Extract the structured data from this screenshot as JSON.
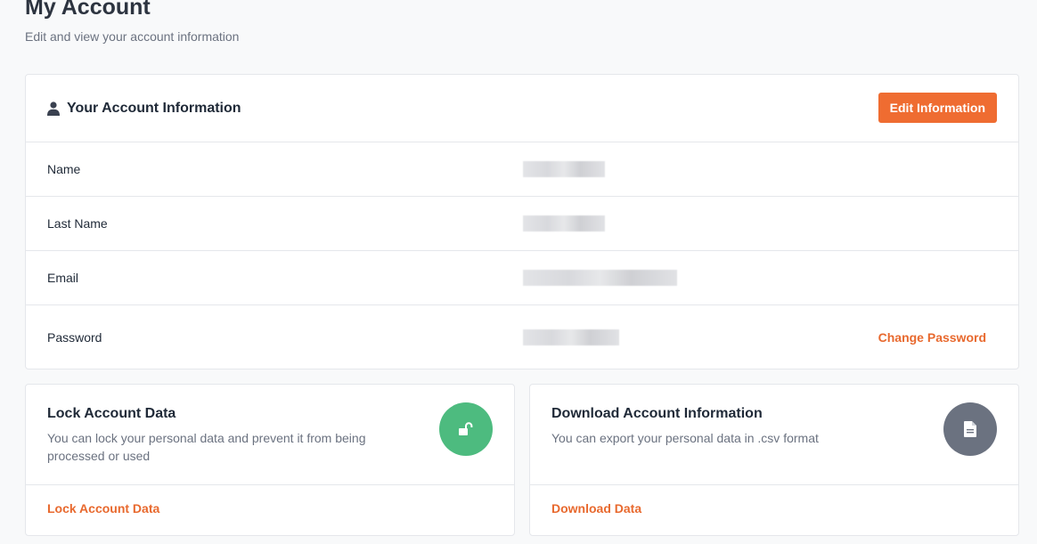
{
  "header": {
    "title": "My Account",
    "subtitle": "Edit and view your account information"
  },
  "account_info": {
    "title": "Your Account Information",
    "edit_label": "Edit Information",
    "rows": [
      {
        "label": "Name"
      },
      {
        "label": "Last Name"
      },
      {
        "label": "Email"
      },
      {
        "label": "Password"
      }
    ],
    "change_password_label": "Change Password"
  },
  "lock_card": {
    "title": "Lock Account Data",
    "description": "You can lock your personal data and prevent it from being processed or used",
    "link_label": "Lock Account Data",
    "icon": "unlock-icon",
    "icon_bg": "#4dbb7f"
  },
  "download_card": {
    "title": "Download Account Information",
    "description": "You can export your personal data in .csv format",
    "link_label": "Download Data",
    "icon": "document-icon",
    "icon_bg": "#6b7280"
  },
  "colors": {
    "accent": "#ef6c31",
    "link": "#e8692e"
  }
}
